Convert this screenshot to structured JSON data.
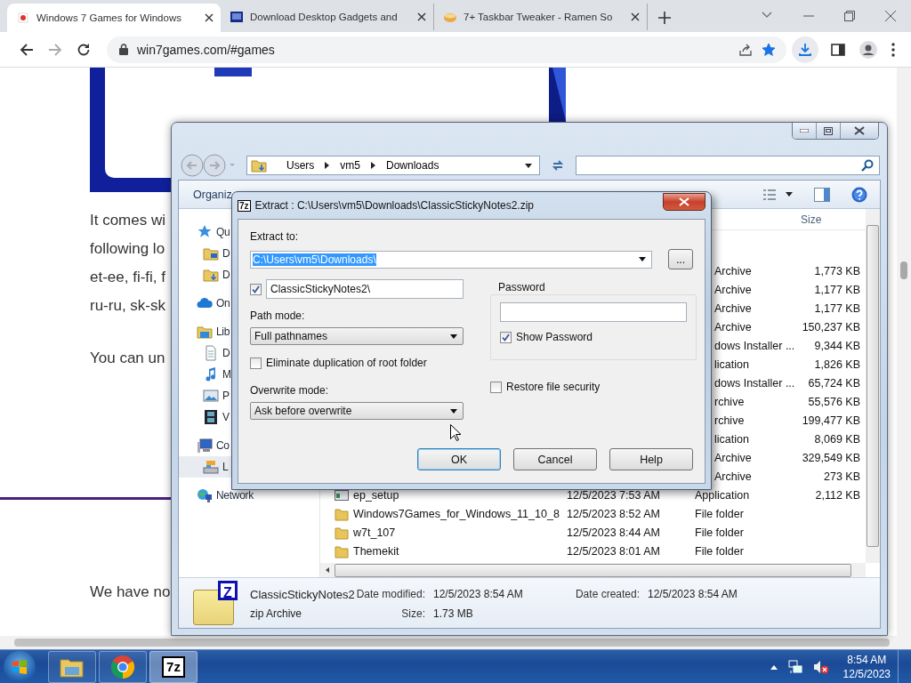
{
  "browser": {
    "tabs": [
      {
        "title": "Windows 7 Games for Windows",
        "kind": "games",
        "selected": true
      },
      {
        "title": "Download Desktop Gadgets and",
        "kind": "gadgets",
        "selected": false
      },
      {
        "title": "7+ Taskbar Tweaker - Ramen So",
        "kind": "ramen",
        "selected": false
      }
    ],
    "url": "win7games.com/#games",
    "bookmarked": true
  },
  "page": {
    "paragraphs": [
      {
        "lines": [
          "It comes wi",
          "following lo",
          "et-ee, fi-fi, f",
          "ru-ru, sk-sk"
        ]
      },
      {
        "lines": [
          "You can un"
        ]
      }
    ],
    "footer_text": "We have no"
  },
  "explorer": {
    "breadcrumb": [
      "Users",
      "vm5",
      "Downloads"
    ],
    "toolbar_label": "Organiz",
    "size_header": "Size",
    "nav": [
      {
        "label": "Qu",
        "kind": "star",
        "selected": false,
        "children": [
          {
            "label": "D",
            "kind": "desktop",
            "selected": false
          },
          {
            "label": "D",
            "kind": "downloads",
            "selected": false
          }
        ]
      },
      {
        "label": "On",
        "kind": "cloud",
        "selected": false
      },
      {
        "label": "Lib",
        "kind": "library",
        "selected": false,
        "children": [
          {
            "label": "D",
            "kind": "document",
            "selected": false
          },
          {
            "label": "M",
            "kind": "music",
            "selected": false
          },
          {
            "label": "P",
            "kind": "pictures",
            "selected": false
          },
          {
            "label": "V",
            "kind": "video",
            "selected": false
          }
        ]
      },
      {
        "label": "Co",
        "kind": "computer",
        "selected": false,
        "children": [
          {
            "label": "L",
            "kind": "drive",
            "selected": true
          }
        ]
      },
      {
        "label": "Network",
        "kind": "network",
        "selected": false
      }
    ],
    "files": [
      {
        "type": "Archive",
        "size": "1,773 KB"
      },
      {
        "type": "Archive",
        "size": "1,177 KB"
      },
      {
        "type": "Archive",
        "size": "1,177 KB"
      },
      {
        "type": "Archive",
        "size": "150,237 KB"
      },
      {
        "type": "dows Installer ...",
        "size": "9,344 KB"
      },
      {
        "type": "lication",
        "size": "1,826 KB"
      },
      {
        "type": "dows Installer ...",
        "size": "65,724 KB"
      },
      {
        "type": "rchive",
        "size": "55,576 KB"
      },
      {
        "type": "rchive",
        "size": "199,477 KB"
      },
      {
        "type": "lication",
        "size": "8,069 KB"
      },
      {
        "type": "Archive",
        "size": "329,549 KB"
      },
      {
        "type": "Archive",
        "size": "273 KB"
      },
      {
        "name": "ep_setup",
        "kind": "app",
        "date": "12/5/2023 7:53 AM",
        "type": "Application",
        "size": "2,112 KB"
      },
      {
        "name": "Windows7Games_for_Windows_11_10_8",
        "kind": "folder",
        "date": "12/5/2023 8:52 AM",
        "type": "File folder"
      },
      {
        "name": "w7t_107",
        "kind": "folder",
        "date": "12/5/2023 8:44 AM",
        "type": "File folder"
      },
      {
        "name": "Themekit",
        "kind": "folder",
        "date": "12/5/2023 8:01 AM",
        "type": "File folder"
      }
    ],
    "details": {
      "icon_letter": "Z",
      "name": "ClassicStickyNotes2",
      "type": "zip Archive",
      "fields": [
        {
          "label": "Date modified:",
          "value": "12/5/2023 8:54 AM"
        },
        {
          "label": "Size:",
          "value": "1.73 MB"
        },
        {
          "label": "Date created:",
          "value": "12/5/2023 8:54 AM"
        }
      ]
    }
  },
  "dialog": {
    "icon_text": "7z",
    "title": "Extract : C:\\Users\\vm5\\Downloads\\ClassicStickyNotes2.zip",
    "extract_to_label": "Extract to:",
    "extract_to": "C:\\Users\\vm5\\Downloads\\",
    "extract_to_selected": true,
    "browse_label": "...",
    "subfolder": {
      "checked": true,
      "value": "ClassicStickyNotes2\\"
    },
    "path_mode": {
      "label": "Path mode:",
      "value": "Full pathnames"
    },
    "eliminate": {
      "label": "Eliminate duplication of root folder",
      "checked": false
    },
    "overwrite_mode": {
      "label": "Overwrite mode:",
      "value": "Ask before overwrite"
    },
    "password": {
      "label": "Password",
      "show": {
        "label": "Show Password",
        "checked": true
      }
    },
    "restore_security": {
      "label": "Restore file security",
      "checked": false
    },
    "buttons": [
      {
        "label": "OK",
        "default": true
      },
      {
        "label": "Cancel",
        "default": false
      },
      {
        "label": "Help",
        "default": false
      }
    ]
  },
  "taskbar": {
    "apps": [
      {
        "kind": "explorer",
        "selected": false
      },
      {
        "kind": "chrome",
        "selected": false
      },
      {
        "kind": "sevenzip",
        "label": "7z",
        "selected": true
      }
    ],
    "time": "8:54 AM",
    "date": "12/5/2023"
  }
}
